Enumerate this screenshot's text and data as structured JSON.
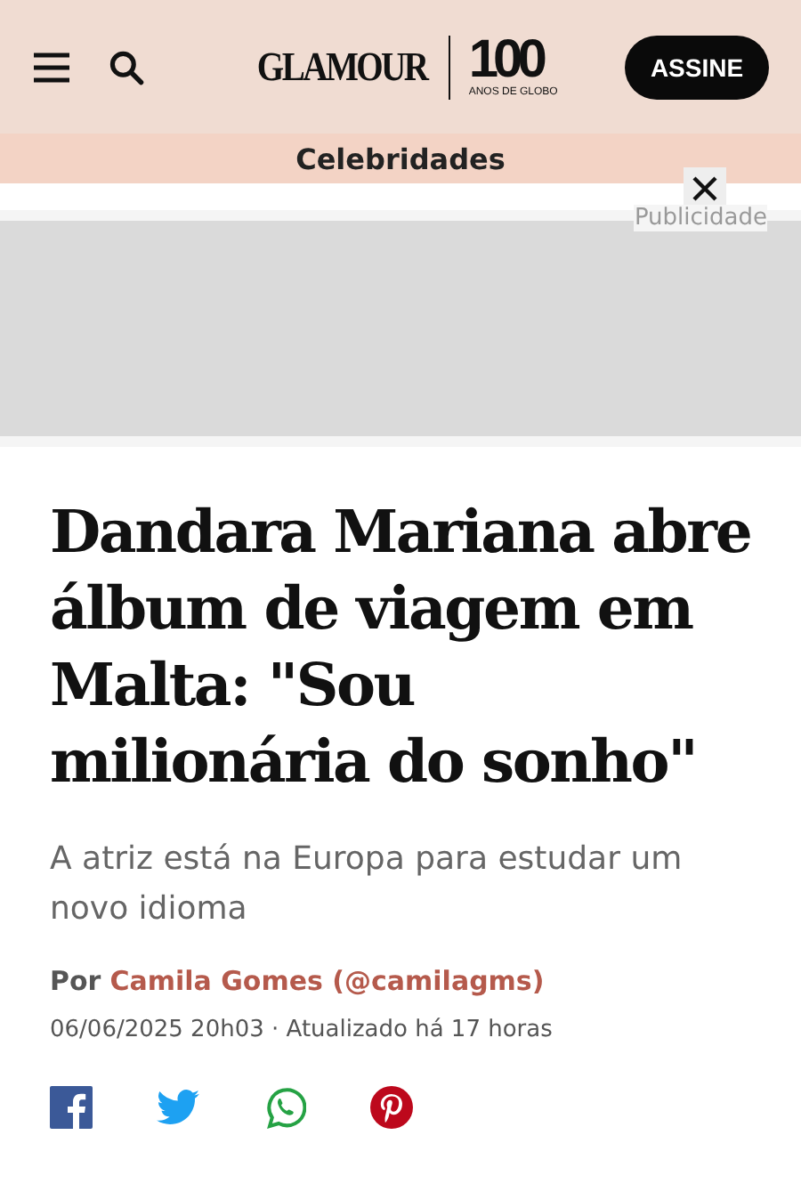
{
  "header": {
    "logo": {
      "brand": "GLAMOUR",
      "number": "100",
      "tagline": "ANOS DE GLOBO"
    },
    "subscribe_button": "ASSINE"
  },
  "section": "Celebridades",
  "ad": {
    "label": "Publicidade"
  },
  "article": {
    "title": "Dandara Mariana abre álbum de viagem em Malta: \"Sou milionária do sonho\"",
    "subtitle": "A atriz está na Europa para estudar um novo idioma",
    "byline_prefix": "Por",
    "author": "Camila Gomes (@camilagms)",
    "timestamp": "06/06/2025 20h03 · Atualizado há 17 horas"
  },
  "share": [
    {
      "kind": "facebook"
    },
    {
      "kind": "twitter"
    },
    {
      "kind": "whatsapp"
    },
    {
      "kind": "pinterest"
    }
  ]
}
